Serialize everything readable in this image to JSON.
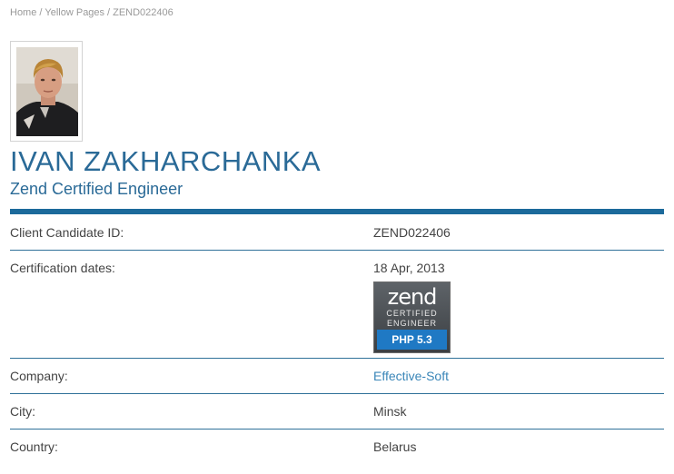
{
  "breadcrumb": {
    "home": "Home",
    "section": "Yellow Pages",
    "current": "ZEND022406",
    "separator": "/"
  },
  "profile": {
    "name": "IVAN ZAKHARCHANKA",
    "title": "Zend Certified Engineer"
  },
  "details": {
    "candidate_id_label": "Client Candidate ID:",
    "candidate_id_value": "ZEND022406",
    "cert_dates_label": "Certification dates:",
    "cert_dates_value": "18 Apr, 2013",
    "company_label": "Company:",
    "company_value": "Effective-Soft",
    "city_label": "City:",
    "city_value": "Minsk",
    "country_label": "Country:",
    "country_value": "Belarus"
  },
  "badge": {
    "brand": "zend",
    "line1": "CERTIFIED",
    "line2": "ENGINEER",
    "version": "PHP 5.3"
  },
  "colors": {
    "accent": "#2a6a97",
    "rule": "#1c6a9b",
    "link": "#3a86b8",
    "badge_blue": "#1f79c4"
  }
}
